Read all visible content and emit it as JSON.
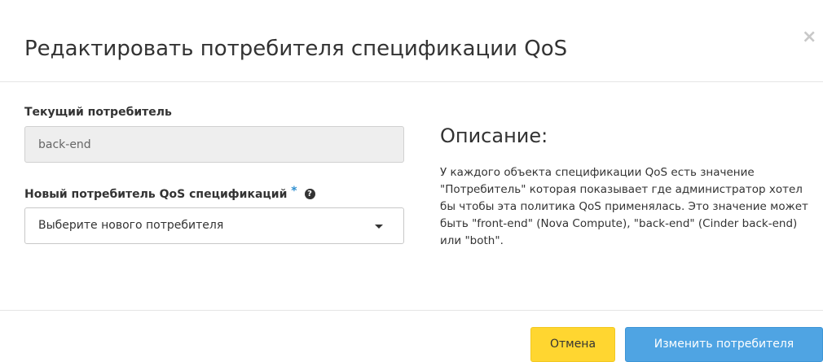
{
  "modal": {
    "title": "Редактировать потребителя спецификации QoS",
    "close_icon": "×"
  },
  "form": {
    "current_label": "Текущий потребитель",
    "current_value": "back-end",
    "new_label": "Новый потребитель QoS спецификаций",
    "required_marker": "*",
    "help_icon": "?",
    "select_value": "Выберите нового потребителя"
  },
  "description": {
    "title": "Описание:",
    "text": "У каждого объекта спецификации QoS есть значение \"Потребитель\" которая показывает где администратор хотел бы чтобы эта политика QoS применялась. Это значение может быть \"front-end\" (Nova Compute), \"back-end\" (Cinder back-end) или \"both\"."
  },
  "footer": {
    "cancel_label": "Отмена",
    "submit_label": "Изменить потребителя"
  },
  "colors": {
    "cancel_button": "#ffd630",
    "submit_button": "#4fa4e3",
    "required_marker": "#2f8fd0"
  }
}
